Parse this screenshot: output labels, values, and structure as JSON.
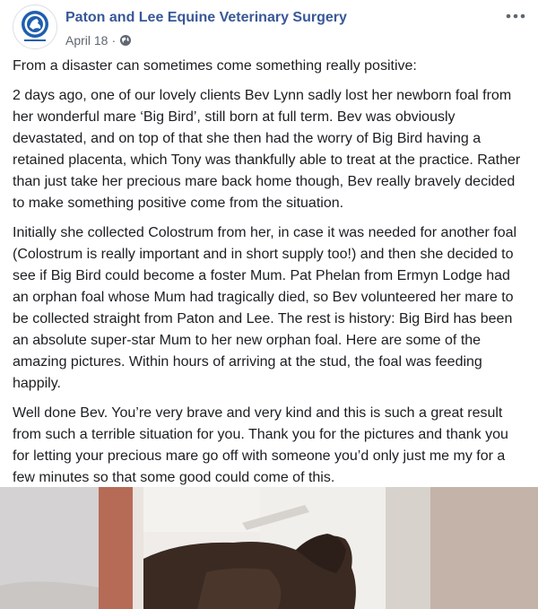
{
  "post": {
    "page_name": "Paton and Lee Equine Veterinary Surgery",
    "date": "April 18",
    "separator": "·",
    "privacy_icon": "globe-icon",
    "more_icon": "more-options-icon",
    "avatar_icon": "clinic-logo-avatar",
    "paragraphs": [
      "From a disaster can sometimes come something really positive:",
      "2 days ago, one of our lovely clients Bev Lynn sadly lost her newborn foal from her wonderful mare ‘Big Bird’, still born at full term. Bev was obviously devastated, and on top of that she then had the worry of Big Bird having a retained placenta, which Tony was thankfully able to treat at the practice. Rather than just take her precious mare back home though, Bev really bravely decided to make something positive come from the situation.",
      "Initially she collected Colostrum from her, in case it was needed for another foal (Colostrum is really important and in short supply too!) and then she decided to see if Big Bird could become a foster Mum. Pat Phelan from Ermyn Lodge had an orphan foal whose Mum had tragically died, so Bev volunteered her mare to be collected straight from Paton and Lee. The rest is history: Big Bird has been an absolute super-star Mum to her new orphan foal. Here are some of the amazing pictures. Within hours of arriving at the stud, the foal was feeding happily.",
      "Well done Bev. You’re very brave and very kind and this is such a great result from such a terrible situation for you. Thank you for the pictures and thank you for letting your precious mare go off with someone you’d only just me my for a few minutes so that some good could come of this."
    ]
  },
  "colors": {
    "link": "#385898",
    "text": "#1c1e21",
    "meta": "#606770",
    "logo_blue": "#1f5fae"
  }
}
